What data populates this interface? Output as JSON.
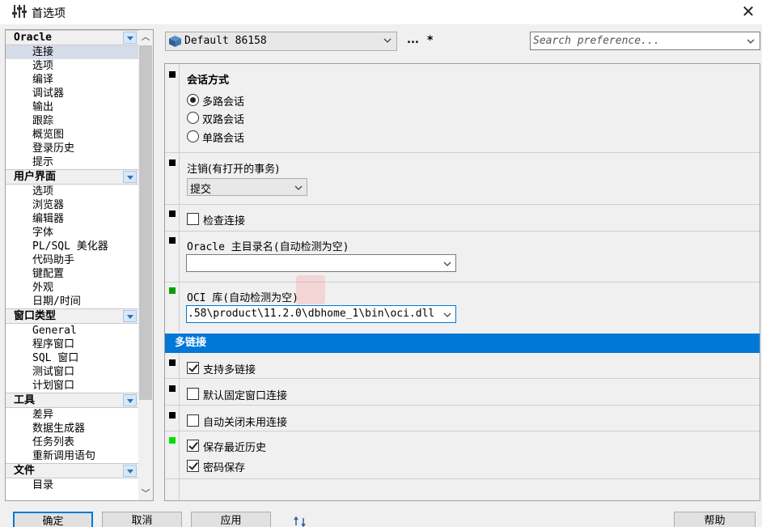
{
  "window": {
    "title": "首选项"
  },
  "nav": {
    "groups": [
      {
        "header": "Oracle",
        "items": [
          "连接",
          "选项",
          "编译",
          "调试器",
          "输出",
          "跟踪",
          "概览图",
          "登录历史",
          "提示"
        ]
      },
      {
        "header": "用户界面",
        "items": [
          "选项",
          "浏览器",
          "编辑器",
          "字体",
          "PL/SQL 美化器",
          "代码助手",
          "键配置",
          "外观",
          "日期/时间"
        ]
      },
      {
        "header": "窗口类型",
        "items": [
          "General",
          "程序窗口",
          "SQL 窗口",
          "测试窗口",
          "计划窗口"
        ]
      },
      {
        "header": "工具",
        "items": [
          "差异",
          "数据生成器",
          "任务列表",
          "重新调用语句"
        ]
      },
      {
        "header": "文件",
        "items": [
          "目录"
        ]
      }
    ],
    "selected": "连接"
  },
  "toolbar": {
    "profile": "Default 86158",
    "ellipsis": "...",
    "modified": "*",
    "search_placeholder": "Search preference..."
  },
  "settings": {
    "session_mode": {
      "label": "会话方式",
      "options": [
        "多路会话",
        "双路会话",
        "单路会话"
      ],
      "selected_index": 0
    },
    "logoff": {
      "label": "注销(有打开的事务)",
      "value": "提交"
    },
    "check_connection": {
      "label": "检查连接",
      "checked": false
    },
    "oracle_home": {
      "label": "Oracle 主目录名(自动检测为空)",
      "value": ""
    },
    "oci_library": {
      "label": "OCI 库(自动检测为空)",
      "value": ".58\\product\\11.2.0\\dbhome_1\\bin\\oci.dll"
    },
    "multi_connection_section": "多链接",
    "support_multi": {
      "label": "支持多链接",
      "checked": true
    },
    "default_fixed_window": {
      "label": "默认固定窗口连接",
      "checked": false
    },
    "auto_close_unused": {
      "label": "自动关闭未用连接",
      "checked": false
    },
    "save_history": {
      "label": "保存最近历史",
      "checked": true
    },
    "save_password": {
      "label": "密码保存",
      "checked": true
    }
  },
  "buttons": {
    "ok": "确定",
    "cancel": "取消",
    "apply": "应用",
    "help": "帮助"
  },
  "colors": {
    "accent": "#0078d7",
    "selection": "#d6dbe9",
    "marker_modified": "#00a000",
    "marker_bright": "#00e000"
  }
}
